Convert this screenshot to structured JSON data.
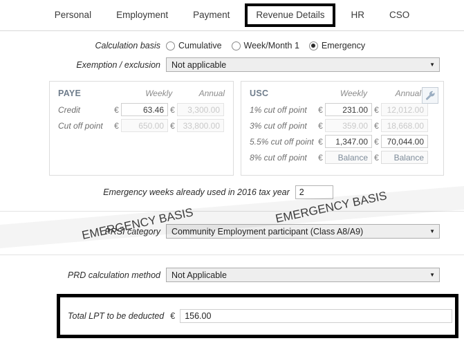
{
  "tabs": [
    {
      "label": "Personal",
      "active": false
    },
    {
      "label": "Employment",
      "active": false
    },
    {
      "label": "Payment",
      "active": false
    },
    {
      "label": "Revenue Details",
      "active": true
    },
    {
      "label": "HR",
      "active": false
    },
    {
      "label": "CSO",
      "active": false
    }
  ],
  "calculation_basis": {
    "label": "Calculation basis",
    "options": [
      {
        "label": "Cumulative",
        "selected": false
      },
      {
        "label": "Week/Month 1",
        "selected": false
      },
      {
        "label": "Emergency",
        "selected": true
      }
    ]
  },
  "exemption": {
    "label": "Exemption / exclusion",
    "value": "Not applicable",
    "caret": "▼"
  },
  "paye_panel": {
    "title": "PAYE",
    "col_weekly": "Weekly",
    "col_annual": "Annual",
    "euro": "€",
    "rows": [
      {
        "label": "Credit",
        "weekly": "63.46",
        "weekly_dim": false,
        "annual": "3,300.00",
        "annual_dim": true
      },
      {
        "label": "Cut off point",
        "weekly": "650.00",
        "weekly_dim": true,
        "annual": "33,800.00",
        "annual_dim": true
      }
    ]
  },
  "usc_panel": {
    "title": "USC",
    "col_weekly": "Weekly",
    "col_annual": "Annual",
    "euro": "€",
    "tool_icon": "wrench-icon",
    "rows": [
      {
        "label": "1% cut off point",
        "weekly": "231.00",
        "weekly_dim": false,
        "annual": "12,012.00",
        "annual_dim": true
      },
      {
        "label": "3% cut off point",
        "weekly": "359.00",
        "weekly_dim": true,
        "annual": "18,668.00",
        "annual_dim": true
      },
      {
        "label": "5.5% cut off point",
        "weekly": "1,347.00",
        "weekly_dim": false,
        "annual": "70,044.00",
        "annual_dim": false
      },
      {
        "label": "8% cut off point",
        "weekly": "Balance",
        "weekly_bal": true,
        "annual": "Balance",
        "annual_bal": true
      }
    ]
  },
  "watermark": {
    "text": "EMERGENCY BASIS"
  },
  "emergency_weeks": {
    "label": "Emergency weeks already used in 2016 tax year",
    "value": "2"
  },
  "prsi": {
    "label": "PRSI category",
    "value": "Community Employment participant (Class A8/A9)",
    "caret": "▼"
  },
  "prd": {
    "label": "PRD calculation method",
    "value": "Not Applicable",
    "caret": "▼"
  },
  "lpt": {
    "label": "Total LPT to be deducted",
    "euro": "€",
    "value": "156.00"
  }
}
